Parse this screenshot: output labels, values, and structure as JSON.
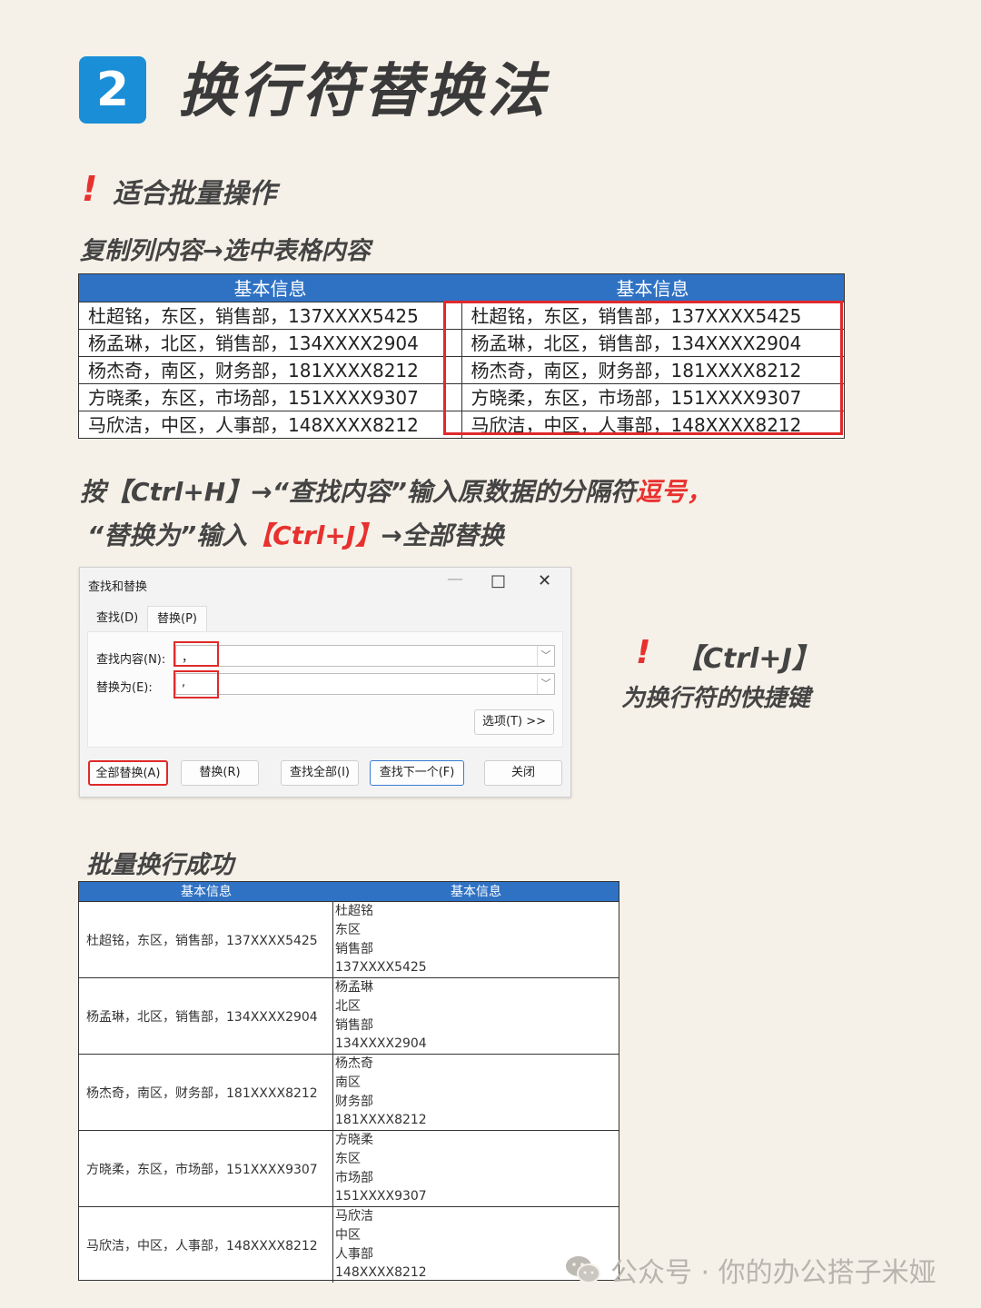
{
  "header": {
    "badge": "2",
    "title": "换行符替换法"
  },
  "note1": {
    "mark": "!",
    "text": "适合批量操作"
  },
  "step1": "复制列内容→选中表格内容",
  "table1": {
    "headers": [
      "基本信息",
      "基本信息"
    ],
    "rows": [
      [
        "杜超铭，东区，销售部，137XXXX5425",
        "杜超铭，东区，销售部，137XXXX5425"
      ],
      [
        "杨孟琳，北区，销售部，134XXXX2904",
        "杨孟琳，北区，销售部，134XXXX2904"
      ],
      [
        "杨杰奇，南区，财务部，181XXXX8212",
        "杨杰奇，南区，财务部，181XXXX8212"
      ],
      [
        "方晓柔，东区，市场部，151XXXX9307",
        "方晓柔，东区，市场部，151XXXX9307"
      ],
      [
        "马欣洁，中区，人事部，148XXXX8212",
        "马欣洁，中区，人事部，148XXXX8212"
      ]
    ]
  },
  "step2": {
    "line1_a": "按【Ctrl+H】→“查找内容”输入原数据的分隔符",
    "line1_b": "逗号，",
    "line2_a": "“替换为”输入",
    "line2_b": "【Ctrl+J】",
    "line2_c": "→全部替换"
  },
  "dialog": {
    "title": "查找和替换",
    "tabs": [
      "查找(D)",
      "替换(P)"
    ],
    "find_label": "查找内容(N):",
    "find_value": "，",
    "replace_label": "替换为(E):",
    "replace_value": ",",
    "options_button": "选项(T) >>",
    "buttons": [
      "全部替换(A)",
      "替换(R)",
      "查找全部(I)",
      "查找下一个(F)",
      "关闭"
    ]
  },
  "note2": {
    "mark": "!",
    "line1": "【Ctrl+J】",
    "line2": "为换行符的快捷键"
  },
  "result_title": "批量换行成功",
  "table2": {
    "headers": [
      "基本信息",
      "基本信息"
    ],
    "rows": [
      {
        "combined": "杜超铭，东区，销售部，137XXXX5425",
        "lines": [
          "杜超铭",
          "东区",
          "销售部",
          "137XXXX5425"
        ]
      },
      {
        "combined": "杨孟琳，北区，销售部，134XXXX2904",
        "lines": [
          "杨孟琳",
          "北区",
          "销售部",
          "134XXXX2904"
        ]
      },
      {
        "combined": "杨杰奇，南区，财务部，181XXXX8212",
        "lines": [
          "杨杰奇",
          "南区",
          "财务部",
          "181XXXX8212"
        ]
      },
      {
        "combined": "方晓柔，东区，市场部，151XXXX9307",
        "lines": [
          "方晓柔",
          "东区",
          "市场部",
          "151XXXX9307"
        ]
      },
      {
        "combined": "马欣洁，中区，人事部，148XXXX8212",
        "lines": [
          "马欣洁",
          "中区",
          "人事部",
          "148XXXX8212"
        ]
      }
    ]
  },
  "watermark": "公众号 · 你的办公搭子米娅",
  "colors": {
    "accent_blue": "#2f72c4",
    "badge_blue": "#1a8fd8",
    "highlight_red": "#e8312f"
  }
}
